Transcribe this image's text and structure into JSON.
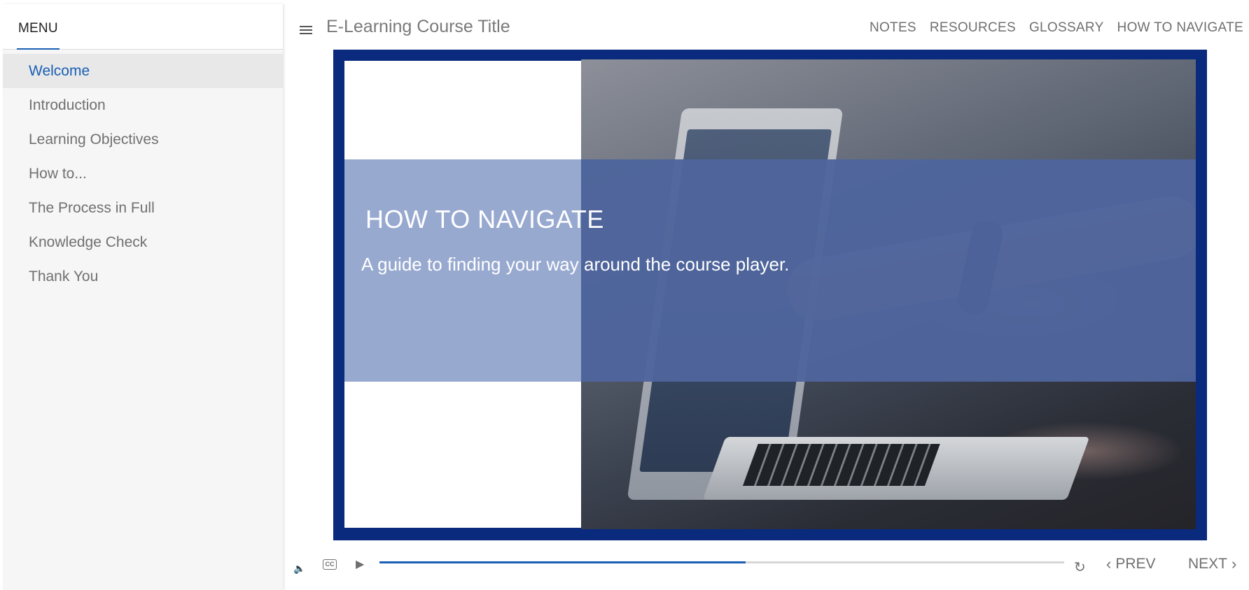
{
  "sidebar": {
    "menu_title": "MENU",
    "items": [
      {
        "label": "Welcome",
        "active": true
      },
      {
        "label": "Introduction"
      },
      {
        "label": "Learning Objectives"
      },
      {
        "label": "How to..."
      },
      {
        "label": "The Process in Full"
      },
      {
        "label": "Knowledge Check"
      },
      {
        "label": "Thank You"
      }
    ]
  },
  "header": {
    "menu_icon": "hamburger-icon",
    "course_title": "E-Learning Course Title",
    "nav": [
      "NOTES",
      "RESOURCES",
      "GLOSSARY",
      "HOW TO NAVIGATE"
    ]
  },
  "slide": {
    "heading": "HOW TO NAVIGATE",
    "subtitle": "A guide to finding your way around the course player.",
    "frame_color": "#0a2a7e",
    "band_color": "#8fa2cc"
  },
  "player": {
    "volume_icon": "volume-icon",
    "captions_icon": "cc-icon",
    "captions_label": "CC",
    "play_icon": "play-icon",
    "progress_percent": 53.5,
    "replay_icon": "replay-icon",
    "prev_label": "PREV",
    "next_label": "NEXT"
  },
  "colors": {
    "accent": "#1a5fb4",
    "sidebar_bg": "#f6f6f6",
    "text_muted": "#707070"
  }
}
